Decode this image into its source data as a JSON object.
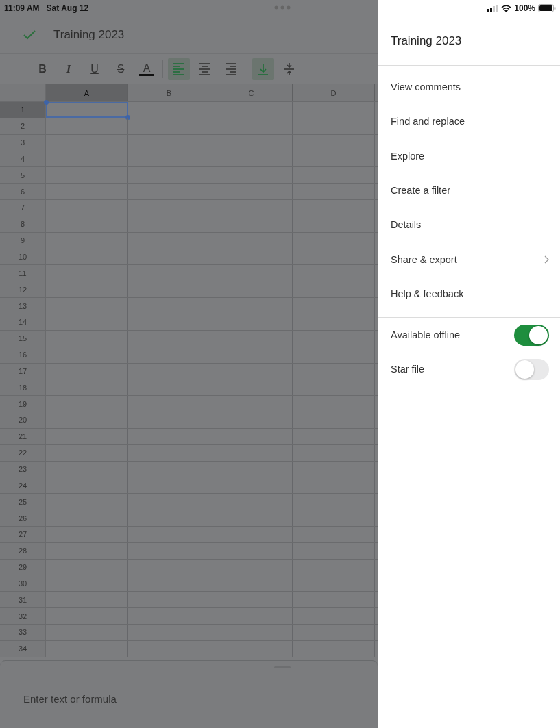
{
  "status_bar": {
    "time": "11:09 AM",
    "date": "Sat Aug 12",
    "battery": "100%"
  },
  "document": {
    "title": "Training 2023"
  },
  "toolbar": {
    "groups": [
      [
        {
          "kind": "bold",
          "label": "B",
          "selected": false
        },
        {
          "kind": "italic",
          "label": "I",
          "selected": false
        },
        {
          "kind": "underline",
          "label": "U",
          "selected": false
        },
        {
          "kind": "strike",
          "label": "S",
          "selected": false
        },
        {
          "kind": "text-color",
          "label": "A",
          "selected": false
        }
      ],
      [
        {
          "kind": "align-left",
          "selected": true
        },
        {
          "kind": "align-center",
          "selected": false
        },
        {
          "kind": "align-right",
          "selected": false
        }
      ],
      [
        {
          "kind": "valign-bottom",
          "selected": true
        },
        {
          "kind": "valign-middle",
          "selected": false
        }
      ]
    ]
  },
  "sheet": {
    "columns": [
      {
        "label": "A",
        "selected": true
      },
      {
        "label": "B",
        "selected": false
      },
      {
        "label": "C",
        "selected": false
      },
      {
        "label": "D",
        "selected": false
      }
    ],
    "rows": [
      {
        "label": "1",
        "selected": true
      },
      {
        "label": "2",
        "selected": false
      },
      {
        "label": "3",
        "selected": false
      },
      {
        "label": "4",
        "selected": false
      },
      {
        "label": "5",
        "selected": false
      },
      {
        "label": "6",
        "selected": false
      },
      {
        "label": "7",
        "selected": false
      },
      {
        "label": "8",
        "selected": false
      },
      {
        "label": "9",
        "selected": false
      },
      {
        "label": "10",
        "selected": false
      },
      {
        "label": "11",
        "selected": false
      },
      {
        "label": "12",
        "selected": false
      },
      {
        "label": "13",
        "selected": false
      },
      {
        "label": "14",
        "selected": false
      },
      {
        "label": "15",
        "selected": false
      },
      {
        "label": "16",
        "selected": false
      },
      {
        "label": "17",
        "selected": false
      },
      {
        "label": "18",
        "selected": false
      },
      {
        "label": "19",
        "selected": false
      },
      {
        "label": "20",
        "selected": false
      },
      {
        "label": "21",
        "selected": false
      },
      {
        "label": "22",
        "selected": false
      },
      {
        "label": "23",
        "selected": false
      },
      {
        "label": "24",
        "selected": false
      },
      {
        "label": "25",
        "selected": false
      },
      {
        "label": "26",
        "selected": false
      },
      {
        "label": "27",
        "selected": false
      },
      {
        "label": "28",
        "selected": false
      },
      {
        "label": "29",
        "selected": false
      },
      {
        "label": "30",
        "selected": false
      },
      {
        "label": "31",
        "selected": false
      },
      {
        "label": "32",
        "selected": false
      },
      {
        "label": "33",
        "selected": false
      },
      {
        "label": "34",
        "selected": false
      }
    ]
  },
  "formula_bar": {
    "placeholder": "Enter text or formula"
  },
  "menu": {
    "title": "Training 2023",
    "items": [
      {
        "kind": "action",
        "label": "View comments"
      },
      {
        "kind": "action",
        "label": "Find and replace"
      },
      {
        "kind": "action",
        "label": "Explore"
      },
      {
        "kind": "action",
        "label": "Create a filter"
      },
      {
        "kind": "action",
        "label": "Details"
      },
      {
        "kind": "submenu",
        "label": "Share & export"
      },
      {
        "kind": "action",
        "label": "Help & feedback"
      }
    ],
    "toggles": [
      {
        "label": "Available offline",
        "on": true
      },
      {
        "label": "Star file",
        "on": false
      }
    ]
  }
}
